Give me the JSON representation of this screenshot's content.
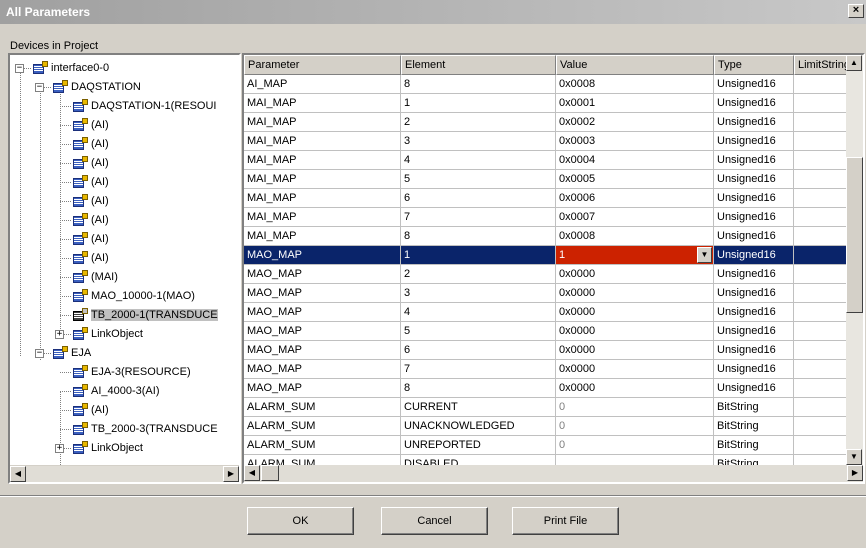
{
  "window": {
    "title": "All Parameters",
    "close_label": "×"
  },
  "devices_label": "Devices in Project",
  "tree": [
    {
      "label": "interface0-0",
      "level": 0
    },
    {
      "label": "DAQSTATION",
      "level": 1
    },
    {
      "label": "DAQSTATION-1(RESOUI",
      "level": 2
    },
    {
      "label": "(AI)",
      "level": 2
    },
    {
      "label": "(AI)",
      "level": 2
    },
    {
      "label": "(AI)",
      "level": 2
    },
    {
      "label": "(AI)",
      "level": 2
    },
    {
      "label": "(AI)",
      "level": 2
    },
    {
      "label": "(AI)",
      "level": 2
    },
    {
      "label": "(AI)",
      "level": 2
    },
    {
      "label": "(AI)",
      "level": 2
    },
    {
      "label": "(MAI)",
      "level": 2
    },
    {
      "label": "MAO_10000-1(MAO)",
      "level": 2
    },
    {
      "label": "TB_2000-1(TRANSDUCE",
      "level": 2
    },
    {
      "label": "LinkObject",
      "level": 2
    },
    {
      "label": "EJA",
      "level": 1
    },
    {
      "label": "EJA-3(RESOURCE)",
      "level": 2
    },
    {
      "label": "AI_4000-3(AI)",
      "level": 2
    },
    {
      "label": "(AI)",
      "level": 2
    },
    {
      "label": "TB_2000-3(TRANSDUCE",
      "level": 2
    },
    {
      "label": "LinkObject",
      "level": 2
    }
  ],
  "grid": {
    "columns": [
      "Parameter",
      "Element",
      "Value",
      "Type",
      "LimitString"
    ],
    "rows": [
      [
        "AI_MAP",
        "8",
        "0x0008",
        "Unsigned16",
        ""
      ],
      [
        "MAI_MAP",
        "1",
        "0x0001",
        "Unsigned16",
        ""
      ],
      [
        "MAI_MAP",
        "2",
        "0x0002",
        "Unsigned16",
        ""
      ],
      [
        "MAI_MAP",
        "3",
        "0x0003",
        "Unsigned16",
        ""
      ],
      [
        "MAI_MAP",
        "4",
        "0x0004",
        "Unsigned16",
        ""
      ],
      [
        "MAI_MAP",
        "5",
        "0x0005",
        "Unsigned16",
        ""
      ],
      [
        "MAI_MAP",
        "6",
        "0x0006",
        "Unsigned16",
        ""
      ],
      [
        "MAI_MAP",
        "7",
        "0x0007",
        "Unsigned16",
        ""
      ],
      [
        "MAI_MAP",
        "8",
        "0x0008",
        "Unsigned16",
        ""
      ],
      [
        "MAO_MAP",
        "1",
        "1",
        "Unsigned16",
        ""
      ],
      [
        "MAO_MAP",
        "2",
        "0x0000",
        "Unsigned16",
        ""
      ],
      [
        "MAO_MAP",
        "3",
        "0x0000",
        "Unsigned16",
        ""
      ],
      [
        "MAO_MAP",
        "4",
        "0x0000",
        "Unsigned16",
        ""
      ],
      [
        "MAO_MAP",
        "5",
        "0x0000",
        "Unsigned16",
        ""
      ],
      [
        "MAO_MAP",
        "6",
        "0x0000",
        "Unsigned16",
        ""
      ],
      [
        "MAO_MAP",
        "7",
        "0x0000",
        "Unsigned16",
        ""
      ],
      [
        "MAO_MAP",
        "8",
        "0x0000",
        "Unsigned16",
        ""
      ],
      [
        "ALARM_SUM",
        "CURRENT",
        "0",
        "BitString",
        ""
      ],
      [
        "ALARM_SUM",
        "UNACKNOWLEDGED",
        "0",
        "BitString",
        ""
      ],
      [
        "ALARM_SUM",
        "UNREPORTED",
        "0",
        "BitString",
        ""
      ],
      [
        "ALARM_SUM",
        "DISABLED",
        "",
        "BitString",
        ""
      ]
    ]
  },
  "buttons": {
    "ok": "OK",
    "cancel": "Cancel",
    "print": "Print File"
  }
}
